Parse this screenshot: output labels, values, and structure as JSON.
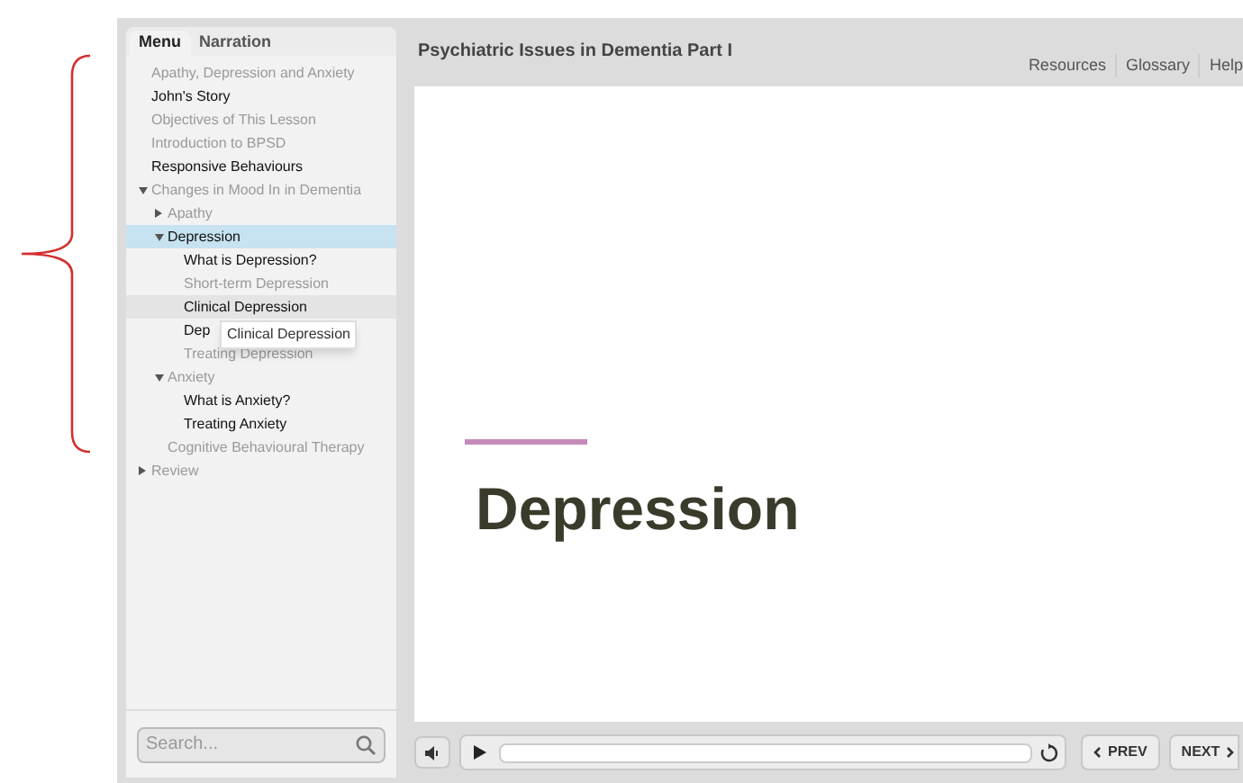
{
  "tabs": [
    {
      "label": "Menu",
      "selected": true
    },
    {
      "label": "Narration",
      "selected": false
    }
  ],
  "menu": [
    {
      "label": "Apathy, Depression and Anxiety",
      "visited": true
    },
    {
      "label": "John's Story",
      "visited": false
    },
    {
      "label": "Objectives of This Lesson",
      "visited": true
    },
    {
      "label": "Introduction to BPSD",
      "visited": true
    },
    {
      "label": "Responsive Behaviours",
      "visited": false
    },
    {
      "label": "Changes in Mood In in Dementia",
      "visited": true,
      "expanded": true,
      "children": [
        {
          "label": "Apathy",
          "visited": true,
          "expanded": false
        },
        {
          "label": "Depression",
          "visited": false,
          "selected": true,
          "expanded": true,
          "children": [
            {
              "label": "What is Depression?",
              "visited": false
            },
            {
              "label": "Short-term Depression",
              "visited": true
            },
            {
              "label": "Clinical Depression",
              "visited": false,
              "hovered": true
            },
            {
              "label": "Dep",
              "visited": false
            },
            {
              "label": "Treating Depression",
              "visited": true
            }
          ]
        },
        {
          "label": "Anxiety",
          "visited": true,
          "expanded": true,
          "children": [
            {
              "label": "What is Anxiety?",
              "visited": false
            },
            {
              "label": "Treating Anxiety",
              "visited": false
            }
          ]
        },
        {
          "label": "Cognitive Behavioural Therapy",
          "visited": true
        }
      ]
    },
    {
      "label": "Review",
      "visited": true,
      "expanded": false
    }
  ],
  "tooltip": "Clinical Depression",
  "search": {
    "placeholder": "Search..."
  },
  "course_title": "Psychiatric Issues in Dementia Part I",
  "links": [
    "Resources",
    "Glossary",
    "Help"
  ],
  "slide": {
    "heading": "Depression"
  },
  "player": {
    "prev": "PREV",
    "next": "NEXT"
  }
}
